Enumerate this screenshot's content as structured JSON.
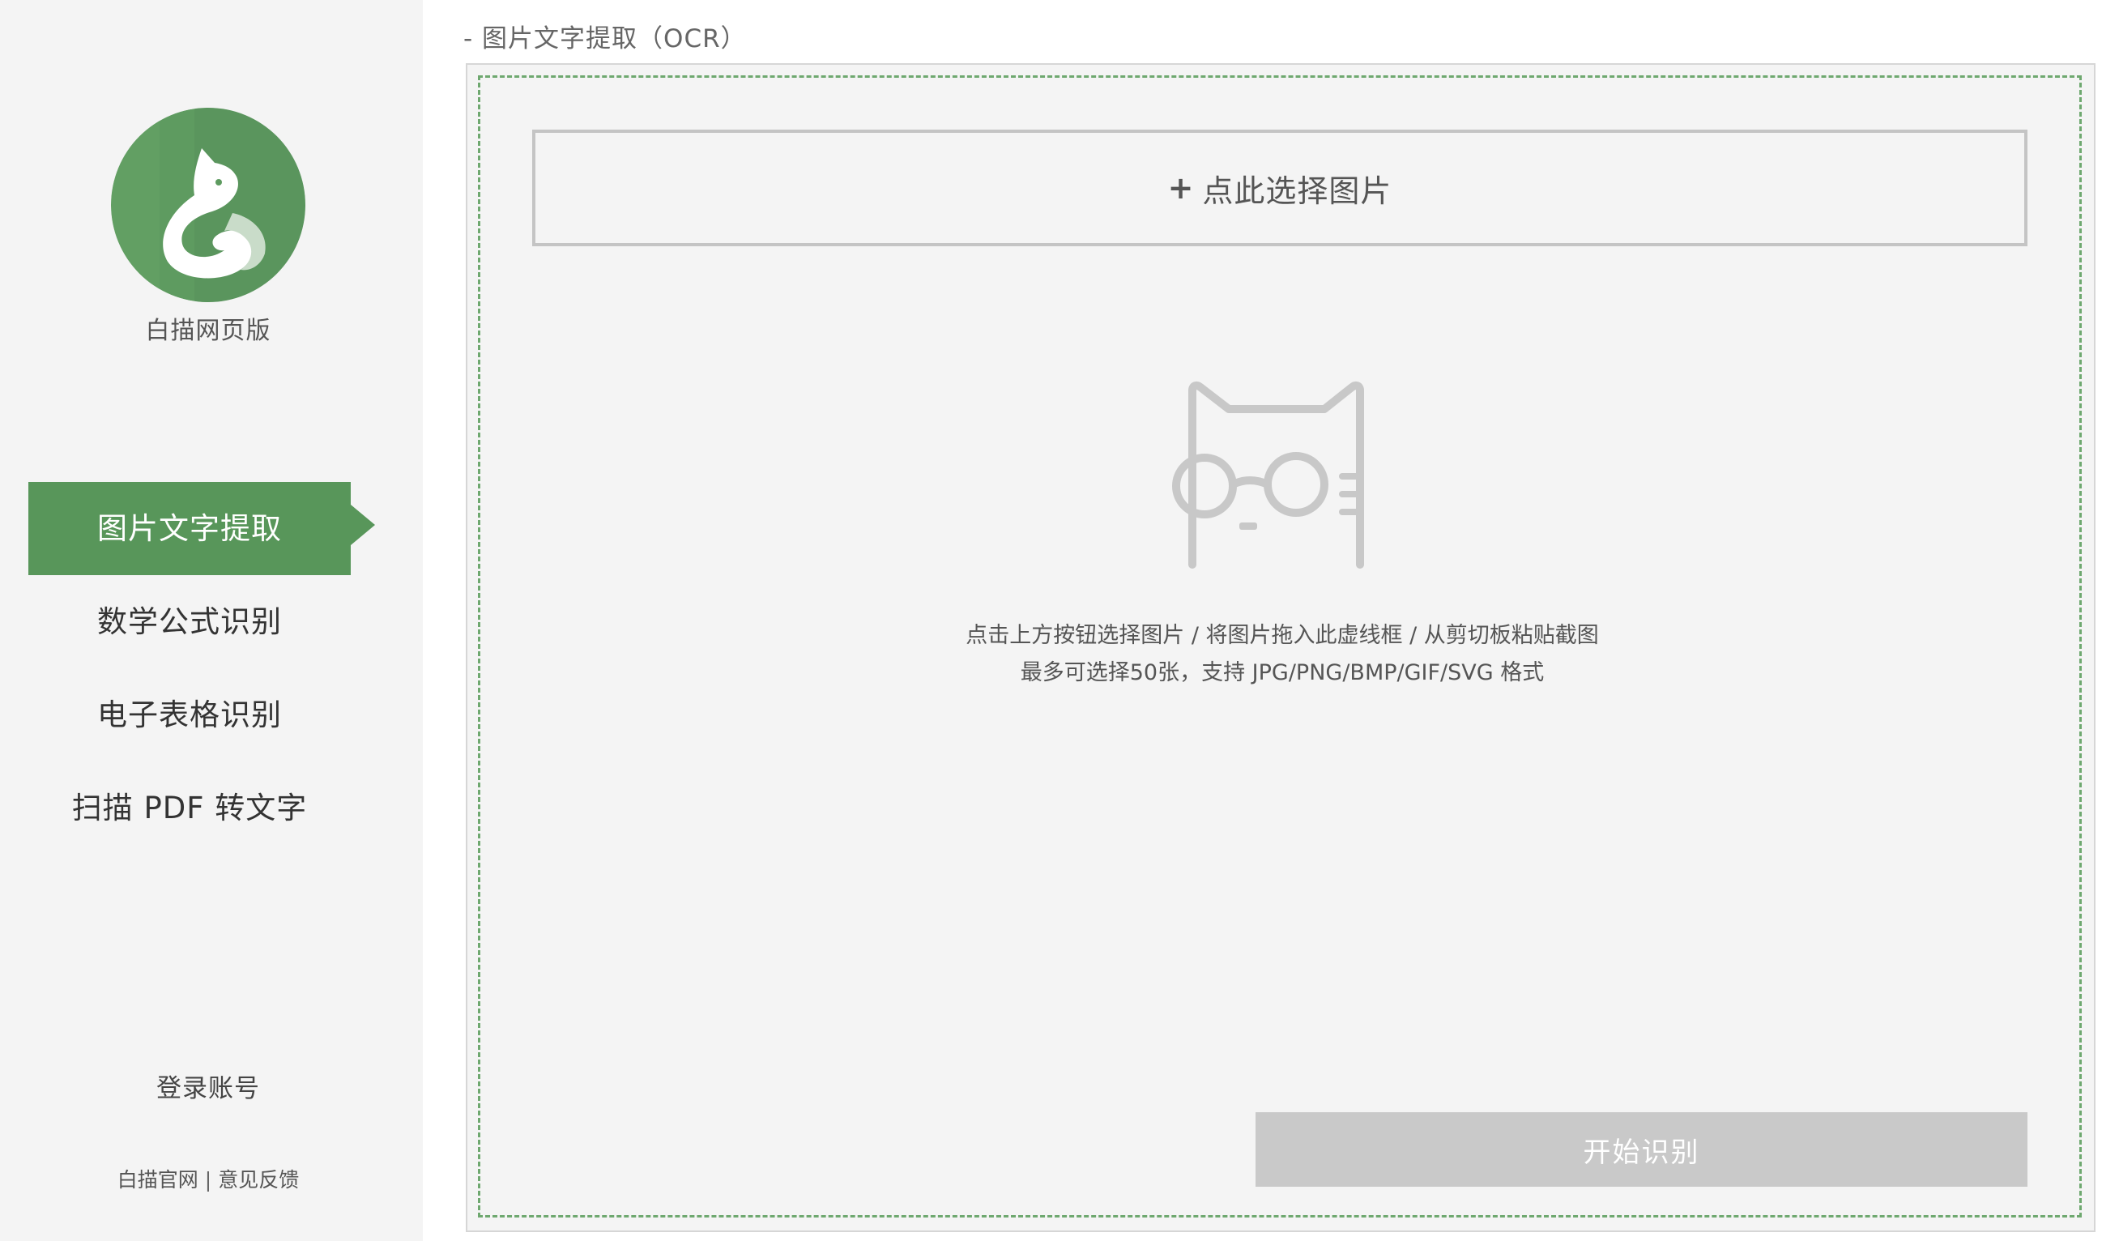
{
  "app": {
    "name": "白描网页版",
    "brand_color": "#58965a"
  },
  "sidebar": {
    "items": [
      {
        "label": "图片文字提取",
        "active": true
      },
      {
        "label": "数学公式识别",
        "active": false
      },
      {
        "label": "电子表格识别",
        "active": false
      },
      {
        "label": "扫描 PDF 转文字",
        "active": false
      }
    ],
    "login": "登录账号",
    "footer": {
      "official_site": "白描官网",
      "separator": "|",
      "feedback": "意见反馈"
    }
  },
  "main": {
    "section_title": "- 图片文字提取（OCR）",
    "select_button": {
      "plus": "+",
      "label": "点此选择图片"
    },
    "illustration_icon": "cat-with-glasses-icon",
    "hint_line_1": "点击上方按钮选择图片 / 将图片拖入此虚线框 / 从剪切板粘贴截图",
    "hint_line_2": "最多可选择50张，支持 JPG/PNG/BMP/GIF/SVG 格式",
    "start_button": "开始识别"
  }
}
